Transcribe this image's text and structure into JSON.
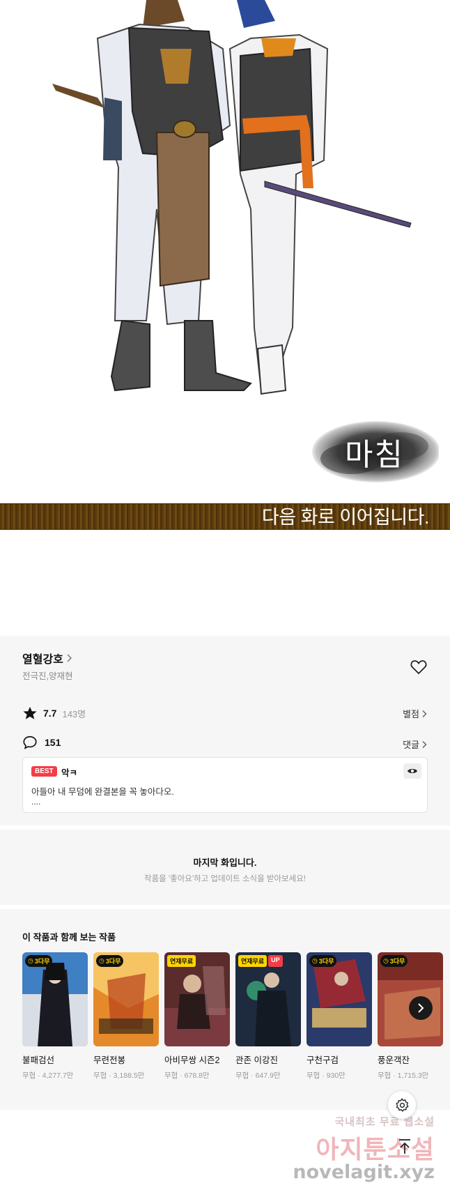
{
  "comic": {
    "end_stamp": "마침",
    "continue_text": "다음 화로 이어집니다."
  },
  "work": {
    "title": "열혈강호",
    "authors": "전극진,양재현",
    "rating": "7.7",
    "rating_count": "143명",
    "rating_link": "별점",
    "comment_count": "151",
    "comment_link": "댓글",
    "best_comment": {
      "badge": "BEST",
      "user": "악ㅋ",
      "text": "아들아 내 무덤에 완결본을 꼭 놓아다오.",
      "more": "...."
    }
  },
  "last_episode": {
    "title": "마지막 화입니다.",
    "subtitle": "작품을 '좋아요'하고 업데이트 소식을 받아보세요!"
  },
  "recommendations": {
    "title": "이 작품과 함께 보는 작품",
    "items": [
      {
        "name": "불패검선",
        "meta": "무협 · 4,277.7만",
        "badge": "3다무",
        "badge2": ""
      },
      {
        "name": "무련전봉",
        "meta": "무협 · 3,188.5만",
        "badge": "3다무",
        "badge2": ""
      },
      {
        "name": "아비무쌍 시즌2",
        "meta": "무협 · 678.8만",
        "badge": "연재무료",
        "badge2": ""
      },
      {
        "name": "관존 이강진",
        "meta": "무협 · 647.9만",
        "badge": "연재무료",
        "badge2": "UP"
      },
      {
        "name": "구천구검",
        "meta": "무협 · 930만",
        "badge": "3다무",
        "badge2": ""
      },
      {
        "name": "풍운객잔",
        "meta": "무협 · 1,715.3만",
        "badge": "3다무",
        "badge2": ""
      }
    ]
  },
  "watermark": {
    "line1": "국내최초 무료 웹소설",
    "line2": "아지툰소설",
    "line3": "novelagit.xyz"
  },
  "icons": [
    "heart-icon",
    "star-icon",
    "comment-icon",
    "eye-icon",
    "chevron-right-icon",
    "settings-icon",
    "arrow-up-icon"
  ],
  "colors": {
    "accent_red": "#f53c44",
    "free_yellow": "#ffd400",
    "banner_brown": "#5a3a0c"
  }
}
